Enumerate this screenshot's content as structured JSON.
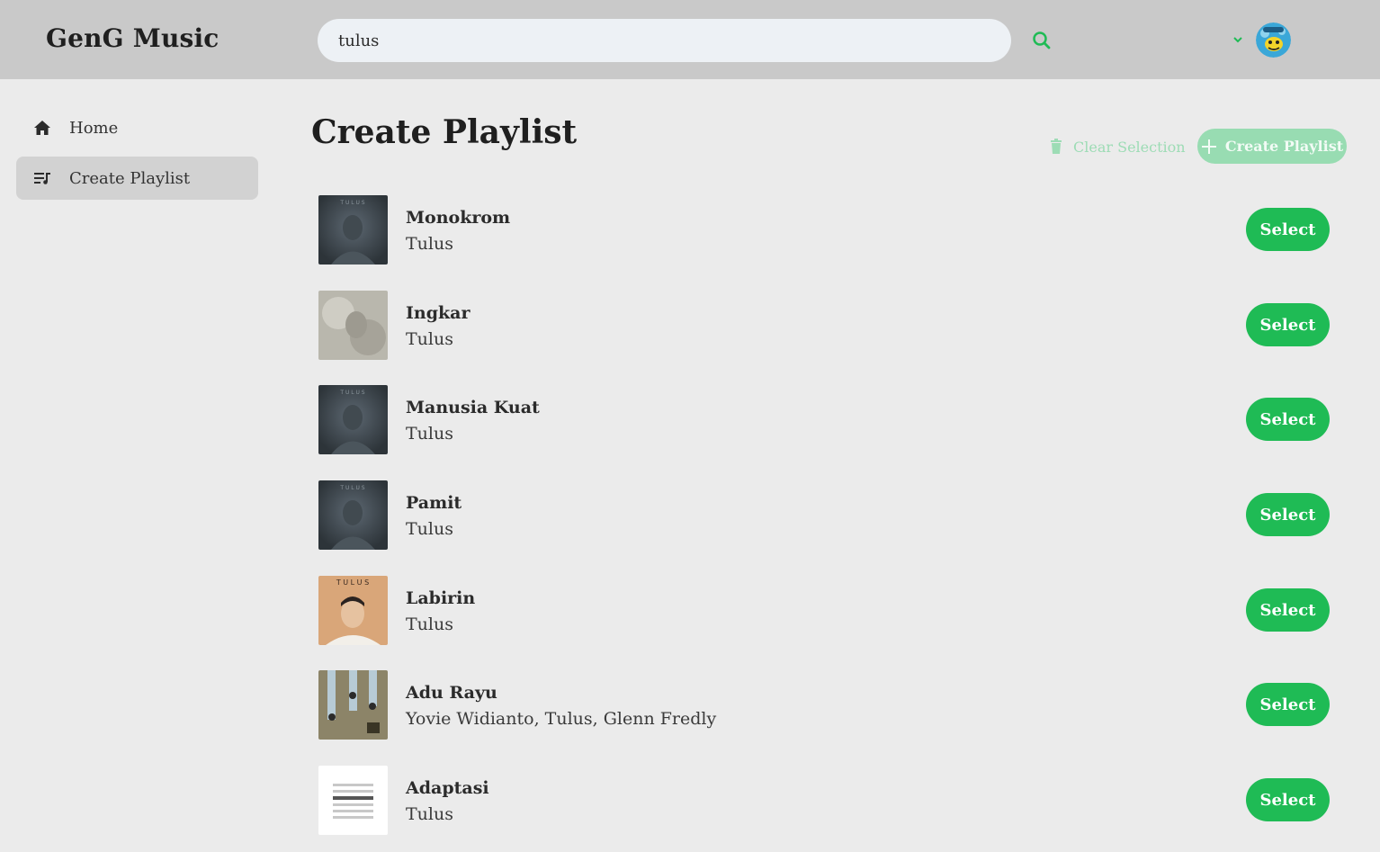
{
  "app": {
    "brand": "GenG Music"
  },
  "search": {
    "value": "tulus"
  },
  "colors": {
    "accent": "#1fbb55",
    "accent_disabled": "#98dcb2",
    "topbar": "#c9c9c9",
    "background": "#ebebeb"
  },
  "sidebar": {
    "items": [
      {
        "label": "Home",
        "icon": "home-icon",
        "active": false
      },
      {
        "label": "Create Playlist",
        "icon": "playlist-icon",
        "active": true
      }
    ]
  },
  "main": {
    "title": "Create Playlist",
    "clear_selection_label": "Clear Selection",
    "create_playlist_label": "Create Playlist",
    "select_label": "Select",
    "songs": [
      {
        "title": "Monokrom",
        "artist": "Tulus",
        "cover": "portrait-dark"
      },
      {
        "title": "Ingkar",
        "artist": "Tulus",
        "cover": "portrait-grey"
      },
      {
        "title": "Manusia Kuat",
        "artist": "Tulus",
        "cover": "portrait-dark"
      },
      {
        "title": "Pamit",
        "artist": "Tulus",
        "cover": "portrait-dark"
      },
      {
        "title": "Labirin",
        "artist": "Tulus",
        "cover": "portrait-tan"
      },
      {
        "title": "Adu Rayu",
        "artist": "Yovie Widianto, Tulus, Glenn Fredly",
        "cover": "trio-columns"
      },
      {
        "title": "Adaptasi",
        "artist": "Tulus",
        "cover": "text-white"
      }
    ]
  }
}
